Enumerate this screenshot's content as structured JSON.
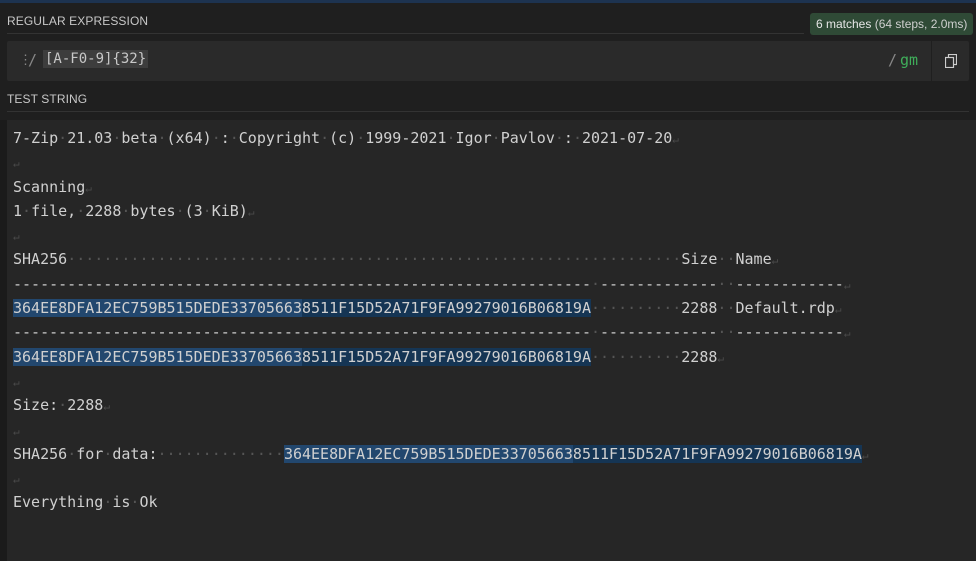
{
  "regex_section": {
    "label": "REGULAR EXPRESSION",
    "match_info": "6 matches",
    "match_detail": " (64 steps, 2.0ms)",
    "delimiter_open": "/",
    "pattern": "[A-F0-9]{32}",
    "delimiter_close": "/",
    "flags": "gm",
    "copy_icon": "copy-icon"
  },
  "test_section": {
    "label": "TEST STRING",
    "lines": [
      "7-Zip 21.03 beta (x64) : Copyright (c) 1999-2021 Igor Pavlov : 2021-07-20",
      "",
      "Scanning",
      "1 file, 2288 bytes (3 KiB)",
      "",
      "SHA256                                                                    Size  Name",
      "---------------------------------------------------------------- -------------  ------------",
      "364EE8DFA12EC759B515DEDE337056638511F15D52A71F9FA99279016B06819A          2288  Default.rdp",
      "---------------------------------------------------------------- -------------  ------------",
      "364EE8DFA12EC759B515DEDE337056638511F15D52A71F9FA99279016B06819A          2288",
      "",
      "Size: 2288",
      "",
      "SHA256 for data:              364EE8DFA12EC759B515DEDE337056638511F15D52A71F9FA99279016B06819A",
      "",
      "Everything is Ok"
    ]
  },
  "colors": {
    "match_a": "#22476e",
    "match_b": "#153554",
    "flags": "#3fae5a",
    "badge": "#2f4a36"
  }
}
